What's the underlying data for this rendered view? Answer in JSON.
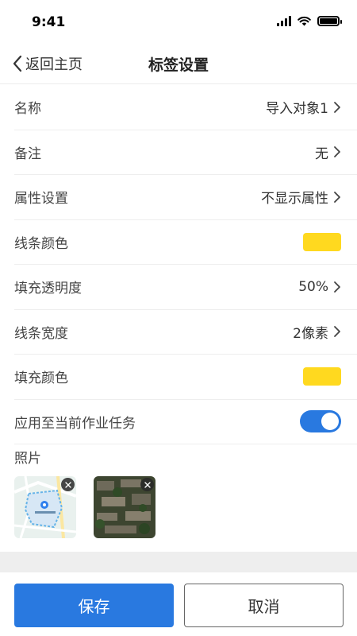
{
  "status": {
    "time": "9:41"
  },
  "nav": {
    "back_label": "返回主页",
    "title": "标签设置"
  },
  "rows": [
    {
      "label": "名称",
      "value": "导入对象1"
    },
    {
      "label": "备注",
      "value": "无"
    },
    {
      "label": "属性设置",
      "value": "不显示属性"
    },
    {
      "label": "线条颜色",
      "color": "#FFD91F"
    },
    {
      "label": "填充透明度",
      "value": "50%"
    },
    {
      "label": "线条宽度",
      "value": "2像素"
    },
    {
      "label": "填充颜色",
      "color": "#FFD91F"
    },
    {
      "label": "应用至当前作业任务",
      "toggle_on": true
    }
  ],
  "photos": {
    "label": "照片",
    "items": [
      {
        "icon": "map-thumbnail"
      },
      {
        "icon": "satellite-thumbnail"
      }
    ]
  },
  "footer": {
    "save_label": "保存",
    "cancel_label": "取消"
  },
  "colors": {
    "accent": "#2979E0",
    "swatch": "#FFD91F"
  }
}
